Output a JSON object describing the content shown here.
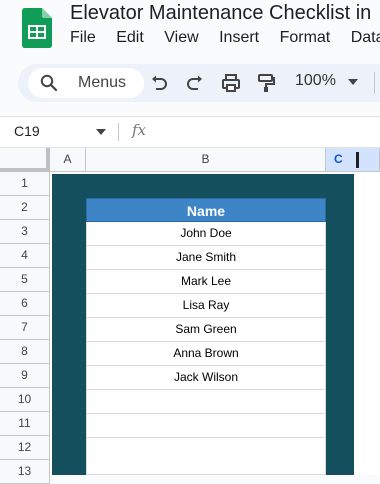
{
  "app": {
    "title": "Elevator Maintenance Checklist in",
    "menus": [
      "File",
      "Edit",
      "View",
      "Insert",
      "Format",
      "Data"
    ]
  },
  "toolbar": {
    "search_label": "Menus",
    "zoom": "100%"
  },
  "formula_bar": {
    "cell_ref": "C19",
    "fx": "fx"
  },
  "grid": {
    "columns": [
      "A",
      "B",
      "C"
    ],
    "rows": [
      "1",
      "2",
      "3",
      "4",
      "5",
      "6",
      "7",
      "8",
      "9",
      "10",
      "11",
      "12",
      "13"
    ],
    "header": "Name",
    "names": [
      "John Doe",
      "Jane Smith",
      "Mark Lee",
      "Lisa Ray",
      "Sam Green",
      "Anna Brown",
      "Jack Wilson",
      "",
      "",
      ""
    ]
  },
  "colors": {
    "teal_background": "#134f5c",
    "header_blue": "#3d85c6",
    "sheets_green": "#0f9d58"
  }
}
